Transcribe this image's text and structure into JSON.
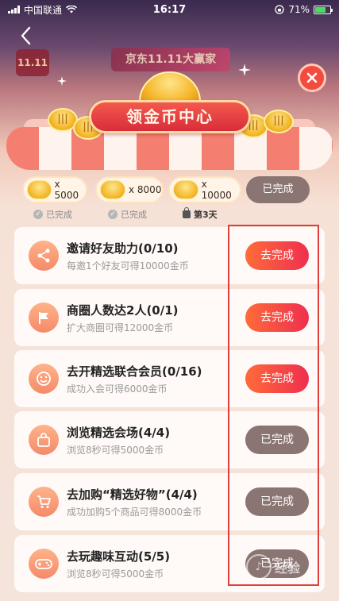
{
  "status_bar": {
    "carrier": "中国联通",
    "time": "16:17",
    "battery": "71%"
  },
  "header": {
    "brand_left": "11.11",
    "brand_banner": "京东11.11大赢家",
    "title": "领金币中心"
  },
  "milestones": {
    "items": [
      {
        "coin_text": "x 5000",
        "label": "已完成",
        "state": "done"
      },
      {
        "coin_text": "x 8000",
        "label": "已完成",
        "state": "done"
      },
      {
        "coin_text": "x 10000",
        "label": "第3天",
        "state": "locked"
      }
    ],
    "button_label": "已完成"
  },
  "tasks": [
    {
      "title": "邀请好友助力(0/10)",
      "subtitle": "每邀1个好友可得10000金币",
      "button": "去完成",
      "state": "todo",
      "icon": "share-icon"
    },
    {
      "title": "商圈人数达2人(0/1)",
      "subtitle": "扩大商圈可得12000金币",
      "button": "去完成",
      "state": "todo",
      "icon": "flag-icon"
    },
    {
      "title": "去开精选联合会员(0/16)",
      "subtitle": "成功入会可得6000金币",
      "button": "去完成",
      "state": "todo",
      "icon": "smile-icon"
    },
    {
      "title": "浏览精选会场(4/4)",
      "subtitle": "浏览8秒可得5000金币",
      "button": "已完成",
      "state": "done",
      "icon": "bag-icon"
    },
    {
      "title": "去加购“精选好物”(4/4)",
      "subtitle": "成功加购5个商品可得8000金币",
      "button": "已完成",
      "state": "done",
      "icon": "cart-icon"
    },
    {
      "title": "去玩趣味互动(5/5)",
      "subtitle": "浏览8秒可得5000金币",
      "button": "已完成",
      "state": "done",
      "icon": "gamepad-icon"
    }
  ],
  "watermark": {
    "text": "经验"
  },
  "colors": {
    "accent_red": "#ef2f4f",
    "accent_orange": "#ff6b3a",
    "done_gray": "#8a7572",
    "highlight": "#e0403b"
  }
}
